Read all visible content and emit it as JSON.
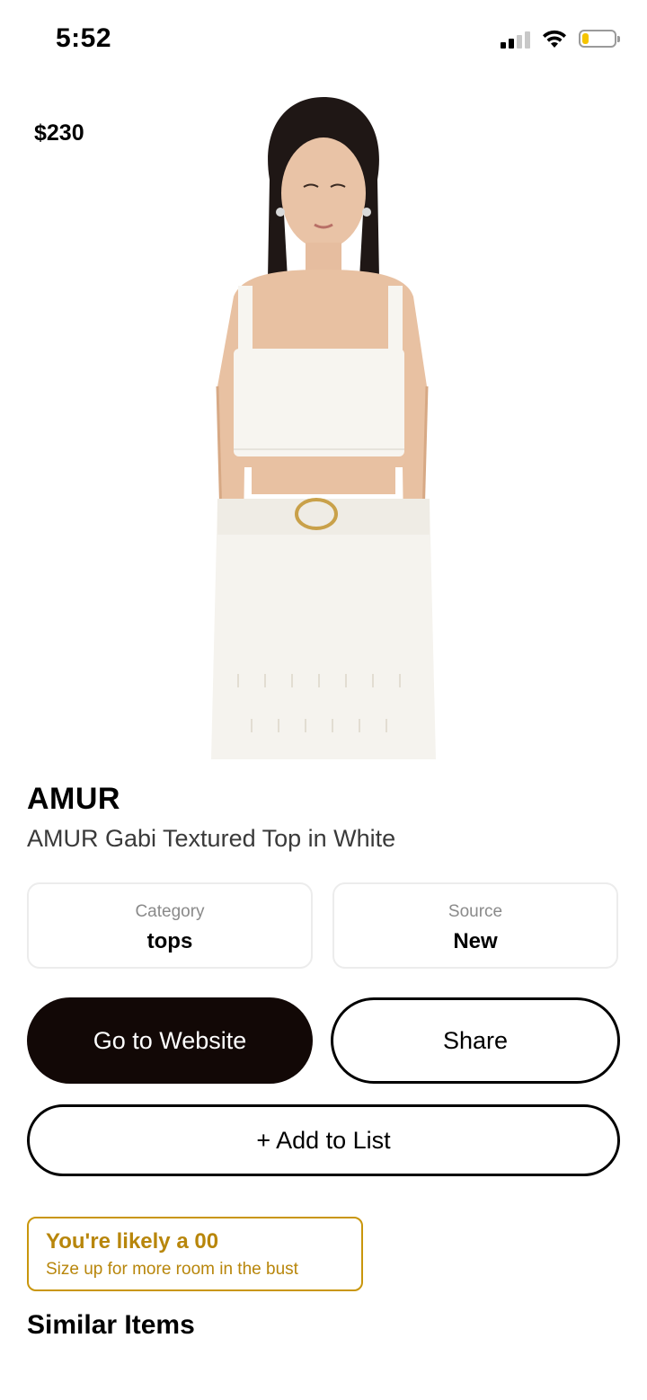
{
  "status_bar": {
    "time": "5:52",
    "battery_level": 0.2,
    "battery_color": "#f5c400"
  },
  "product": {
    "price": "$230",
    "brand": "AMUR",
    "name": "AMUR Gabi Textured Top in White",
    "image_alt": "model wearing white textured crop top and white skirt"
  },
  "info_cards": {
    "category": {
      "label": "Category",
      "value": "tops"
    },
    "source": {
      "label": "Source",
      "value": "New"
    }
  },
  "actions": {
    "website_label": "Go to Website",
    "share_label": "Share",
    "add_list_label": "+ Add to List"
  },
  "size_tip": {
    "title": "You're likely a 00",
    "subtitle": "Size up for more room in the bust",
    "accent_color": "#b8860b"
  },
  "similar": {
    "heading": "Similar Items"
  }
}
